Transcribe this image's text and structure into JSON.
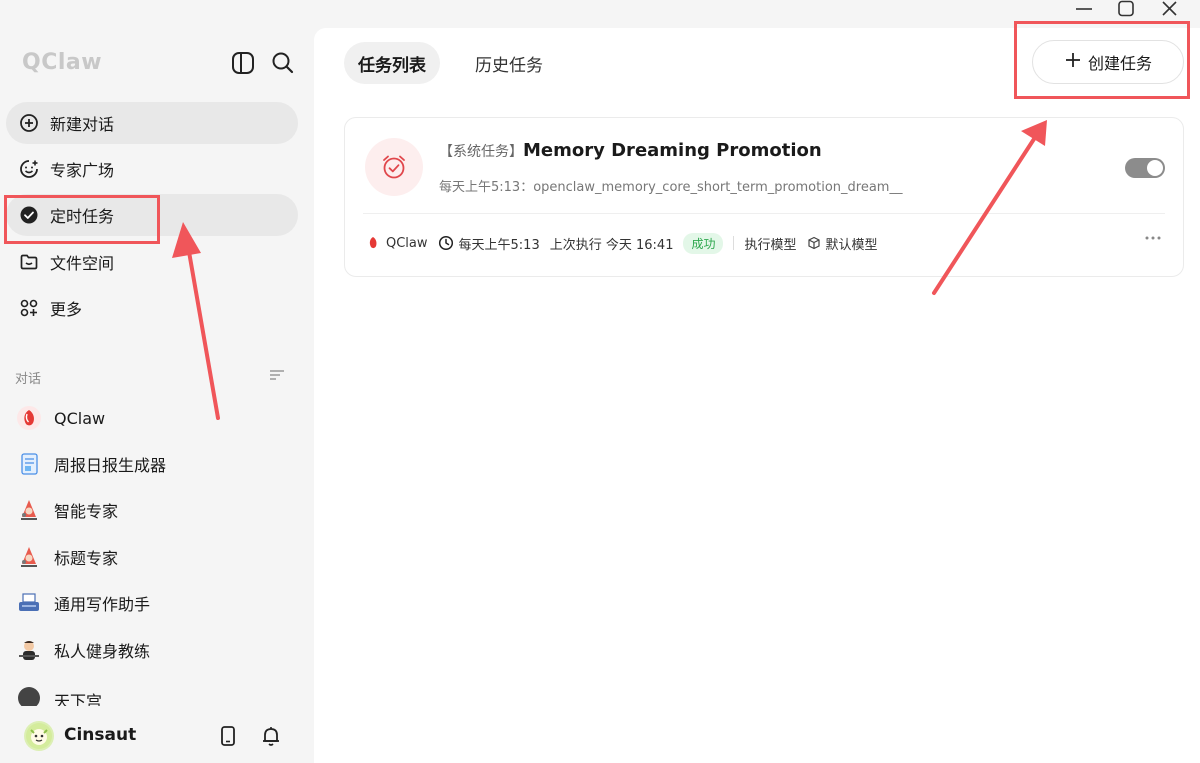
{
  "app": {
    "brand": "QClaw"
  },
  "sidebar": {
    "nav": [
      {
        "id": "new-chat",
        "label": "新建对话",
        "active": true
      },
      {
        "id": "experts",
        "label": "专家广场",
        "active": false
      },
      {
        "id": "scheduled",
        "label": "定时任务",
        "active": true
      },
      {
        "id": "files",
        "label": "文件空间",
        "active": false
      },
      {
        "id": "more",
        "label": "更多",
        "active": false
      }
    ],
    "section_label": "对话",
    "conversations": [
      {
        "label": "QClaw",
        "icon": "qclaw-logo-icon"
      },
      {
        "label": "周报日报生成器",
        "icon": "document-icon"
      },
      {
        "label": "智能专家",
        "icon": "expert-icon"
      },
      {
        "label": "标题专家",
        "icon": "expert-icon"
      },
      {
        "label": "通用写作助手",
        "icon": "typewriter-icon"
      },
      {
        "label": "私人健身教练",
        "icon": "fitness-icon"
      },
      {
        "label": "天下宫",
        "icon": "avatar-icon"
      }
    ],
    "user": {
      "name": "Cinsaut"
    }
  },
  "main": {
    "tabs": [
      {
        "label": "任务列表",
        "active": true
      },
      {
        "label": "历史任务",
        "active": false
      }
    ],
    "create_button": "创建任务",
    "task": {
      "prefix": "【系统任务】",
      "title": "Memory Dreaming Promotion",
      "description": "每天上午5:13：openclaw_memory_core_short_term_promotion_dream__",
      "enabled": true,
      "agent": "QClaw",
      "schedule": "每天上午5:13",
      "last_run": "上次执行 今天 16:41",
      "status": "成功",
      "model_label": "执行模型",
      "model": "默认模型"
    }
  },
  "colors": {
    "accent_red": "#f0565a",
    "success_green": "#2fa84f",
    "sidebar_bg": "#f5f5f5"
  }
}
